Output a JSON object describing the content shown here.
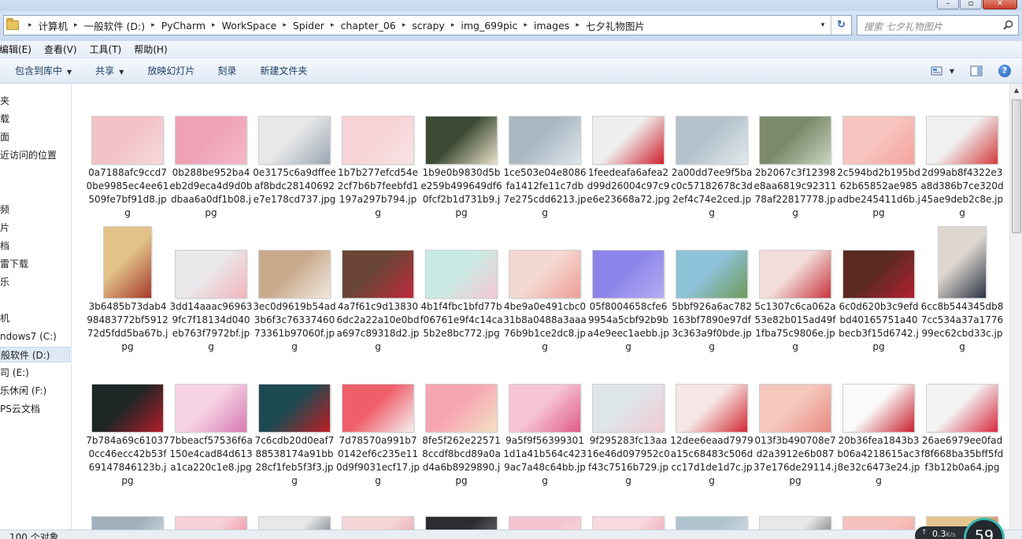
{
  "window": {
    "minimize_glyph": "–",
    "maximize_glyph": "▫",
    "close_glyph": "✕"
  },
  "address": {
    "crumbs": [
      "计算机",
      "一般软件 (D:)",
      "PyCharm",
      "WorkSpace",
      "Spider",
      "chapter_06",
      "scrapy",
      "img_699pic",
      "images",
      "七夕礼物图片"
    ],
    "separator_glyph": "▸",
    "dropdown_glyph": "▾",
    "refresh_glyph": "↻"
  },
  "search": {
    "placeholder": "搜索 七夕礼物图片"
  },
  "menu": {
    "edit": "编辑(E)",
    "view": "查看(V)",
    "tools": "工具(T)",
    "help": "帮助(H)"
  },
  "commands": {
    "include_in_library": "包含到库中",
    "share": "共享",
    "slideshow": "放映幻灯片",
    "burn": "刻录",
    "new_folder": "新建文件夹",
    "dropdown_glyph": "▼",
    "help_glyph": "?"
  },
  "nav": {
    "items": [
      "夹",
      "载",
      "面",
      "近访问的位置",
      "频",
      "片",
      "档",
      "雷下载",
      "乐",
      "机",
      "ndows7 (C:)",
      "般软件 (D:)",
      "司 (E:)",
      "乐休闲 (F:)",
      "PS云文档"
    ]
  },
  "files": [
    {
      "name": "0a7188afc9ccd70be9985ec4ee61509fe7bf91d8.jpg",
      "colors": [
        "#f2c0c8",
        "#f7d9dd"
      ]
    },
    {
      "name": "0b288be952ba4eb2d9eca4d9d0bdbaa6a0df1b08.jpg",
      "colors": [
        "#efa1b6",
        "#f4b8c8"
      ]
    },
    {
      "name": "0e3175c6a9dffeeaf8bdc28140692e7e178cd737.jpg",
      "colors": [
        "#e8e8e8",
        "#9aa6b3"
      ]
    },
    {
      "name": "1b7b277efcd54e2cf7b6b7feebfd1197a297b794.jpg",
      "colors": [
        "#f7d2d6",
        "#f9e4e6"
      ]
    },
    {
      "name": "1b9e0b9830d5be259b499649df60fcf2b1d731b9.jpg",
      "colors": [
        "#3e4a34",
        "#e8e2c8"
      ]
    },
    {
      "name": "1ce503e04e8086fa1412fe11c7db7e275cdd6213.jpg",
      "colors": [
        "#aab8c4",
        "#dfe6ea"
      ]
    },
    {
      "name": "1feedeafa6afea2d99d26004c97c9e6e23668a72.jpg",
      "colors": [
        "#eeeeee",
        "#d0202c"
      ]
    },
    {
      "name": "2a00dd7ee9f5bac0c57182678c3d2ef4c74e2ced.jpg",
      "colors": [
        "#b3c2cc",
        "#e3e8ea"
      ]
    },
    {
      "name": "2b2067c3f12398e8aa6819c9231178af22817778.jpg",
      "colors": [
        "#7c8a6a",
        "#c9d3c0"
      ]
    },
    {
      "name": "2c594bd2b195bd62b65852ae985adbe245411d6b.jpg",
      "colors": [
        "#f7c5c0",
        "#f5a59e"
      ]
    },
    {
      "name": "2d99ab8f4322e3a8d386b7ce320d45ae9deb2c8e.jpg",
      "colors": [
        "#f0f0f0",
        "#d43b3b"
      ]
    },
    {
      "name": "3b6485b73dab498483772bf591272d5fdd5ba67b.jpg",
      "colors": [
        "#e2c287",
        "#a63a2c"
      ]
    },
    {
      "name": "3dd14aaac969639fc7f18134d040eb763f7972bf.jpg",
      "colors": [
        "#e9e9eb",
        "#f3b4bd"
      ]
    },
    {
      "name": "3ec0d9619b54ad3b6f3c7633746073361b97060f.jpg",
      "colors": [
        "#c9a98b",
        "#f1e9de"
      ]
    },
    {
      "name": "4a7f61c9d138306dc2a22a10e0bda697c89318d2.jpg",
      "colors": [
        "#6b4535",
        "#c02a3e"
      ]
    },
    {
      "name": "4b1f4fbc1bfd77bf06761e9f4c14ca5b2e8bc772.jpg",
      "colors": [
        "#c8ece4",
        "#f4c7d2"
      ]
    },
    {
      "name": "4be9a0e491cbc031b8a0488a3aaa76b9b1ce2dc8.jpg",
      "colors": [
        "#f4d9d3",
        "#ee9f96"
      ]
    },
    {
      "name": "05f8004658cfe69954a5cbf92b9ba4e9eec1aebb.jpg",
      "colors": [
        "#8d84ea",
        "#b3adf2"
      ]
    },
    {
      "name": "5bbf926a6ac782163bf7890e97df3c363a9f0bde.jpg",
      "colors": [
        "#8ec2d8",
        "#6e9a5a"
      ]
    },
    {
      "name": "5c1307c6ca062a53e82b015ad49f1fba75c9806e.jpg",
      "colors": [
        "#f2dedb",
        "#c8343c"
      ]
    },
    {
      "name": "6c0d620b3c9efdbd40165751a40becb3f15d6742.jpg",
      "colors": [
        "#5a2a22",
        "#b02030"
      ]
    },
    {
      "name": "6cc8b544345db87cc534a37a177699ec62cbd33c.jpg",
      "colors": [
        "#dcd6cf",
        "#2c3344"
      ]
    },
    {
      "name": "7b784a69c610370cc46ecc42b53f69147846123b.jpg",
      "colors": [
        "#1e2626",
        "#b21e28"
      ]
    },
    {
      "name": "7bbeacf57536f6a150e4cad84d613a1ca220c1e8.jpg",
      "colors": [
        "#f7d3e4",
        "#d679b2"
      ]
    },
    {
      "name": "7c6cdb20d0eaf788538174a91bb28cf1feb5f3f3.jpg",
      "colors": [
        "#1c4a50",
        "#c01e26"
      ]
    },
    {
      "name": "7d78570a991b70142ef6c235e110d9f9031ecf17.jpg",
      "colors": [
        "#ef5f6a",
        "#f6f1f1"
      ]
    },
    {
      "name": "8fe5f262e225718ccdf8bcd89a0ad4a6b8929890.jpg",
      "colors": [
        "#f7a5b3",
        "#f3e1c3"
      ]
    },
    {
      "name": "9a5f9f563993011d1a41b564c4239ac7a48c64bb.jpg",
      "colors": [
        "#f6c6d6",
        "#e05a8a"
      ]
    },
    {
      "name": "9f295283fc13aa16e46d097952c0f43c7516b729.jpg",
      "colors": [
        "#dfe6ea",
        "#f1c9d3"
      ]
    },
    {
      "name": "12dee6eaad7979a15c68483c506dcc17d1de1d7c.jpg",
      "colors": [
        "#f6e6e6",
        "#d22a32"
      ]
    },
    {
      "name": "013f3b490708e7d2a3912e6b08737e176de29114.jpg",
      "colors": [
        "#f5c8be",
        "#e88a80"
      ]
    },
    {
      "name": "20b36fea1843b3b06a4218615ac38e32c6473e24.jpg",
      "colors": [
        "#fafafa",
        "#c8202c"
      ]
    },
    {
      "name": "26ae6979ee0fadf8f668ba35bff5fdf3b12b0a64.jpg",
      "colors": [
        "#f3f3f3",
        "#d8283e"
      ]
    }
  ],
  "partial_row_colors": [
    [
      "#9fb0bc",
      "#e9eef1"
    ],
    [
      "#f7d0d8",
      "#e66a84"
    ],
    [
      "#e8e8e8",
      "#33424f"
    ],
    [
      "#f5d6d8",
      "#e5909a"
    ],
    [
      "#2c2c30",
      "#8a8a90"
    ],
    [
      "#f4c3cf",
      "#f9e1e7"
    ],
    [
      "#f8d9df",
      "#ef8aa0"
    ],
    [
      "#b0c4d0",
      "#e0e8ee"
    ],
    [
      "#e8e8e8",
      "#3a3a40"
    ],
    [
      "#f7c2bd",
      "#f5a09a"
    ],
    [
      "#e3c48e",
      "#b13a30"
    ]
  ],
  "status": {
    "count": "100 个对象"
  },
  "net": {
    "arrow": "↑",
    "speed": "0.3",
    "unit": "K/s",
    "percent": "59"
  }
}
